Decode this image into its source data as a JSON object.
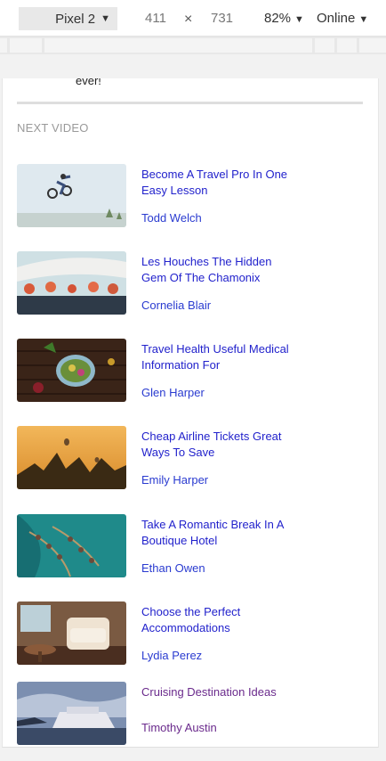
{
  "toolbar": {
    "device": "Pixel 2",
    "width": "411",
    "times": "×",
    "height": "731",
    "zoom": "82%",
    "network": "Online",
    "caret": "▼"
  },
  "page": {
    "previous_text": "ever!",
    "section_label": "NEXT VIDEO",
    "videos": [
      {
        "title": "Become A Travel Pro In One Easy Lesson",
        "author": "Todd Welch"
      },
      {
        "title": "Les Houches The Hidden Gem Of The Chamonix",
        "author": "Cornelia Blair"
      },
      {
        "title": "Travel Health Useful Medical Information For",
        "author": "Glen Harper"
      },
      {
        "title": "Cheap Airline Tickets Great Ways To Save",
        "author": "Emily Harper"
      },
      {
        "title": "Take A Romantic Break In A Boutique Hotel",
        "author": "Ethan Owen"
      },
      {
        "title": "Choose the Perfect Accommodations",
        "author": "Lydia Perez"
      },
      {
        "title": "Cruising Destination Ideas",
        "author": "Timothy Austin"
      }
    ]
  },
  "colors": {
    "link": "#2222cc",
    "visited_link": "#6a2a8c",
    "section_label": "#9a9a9a"
  }
}
